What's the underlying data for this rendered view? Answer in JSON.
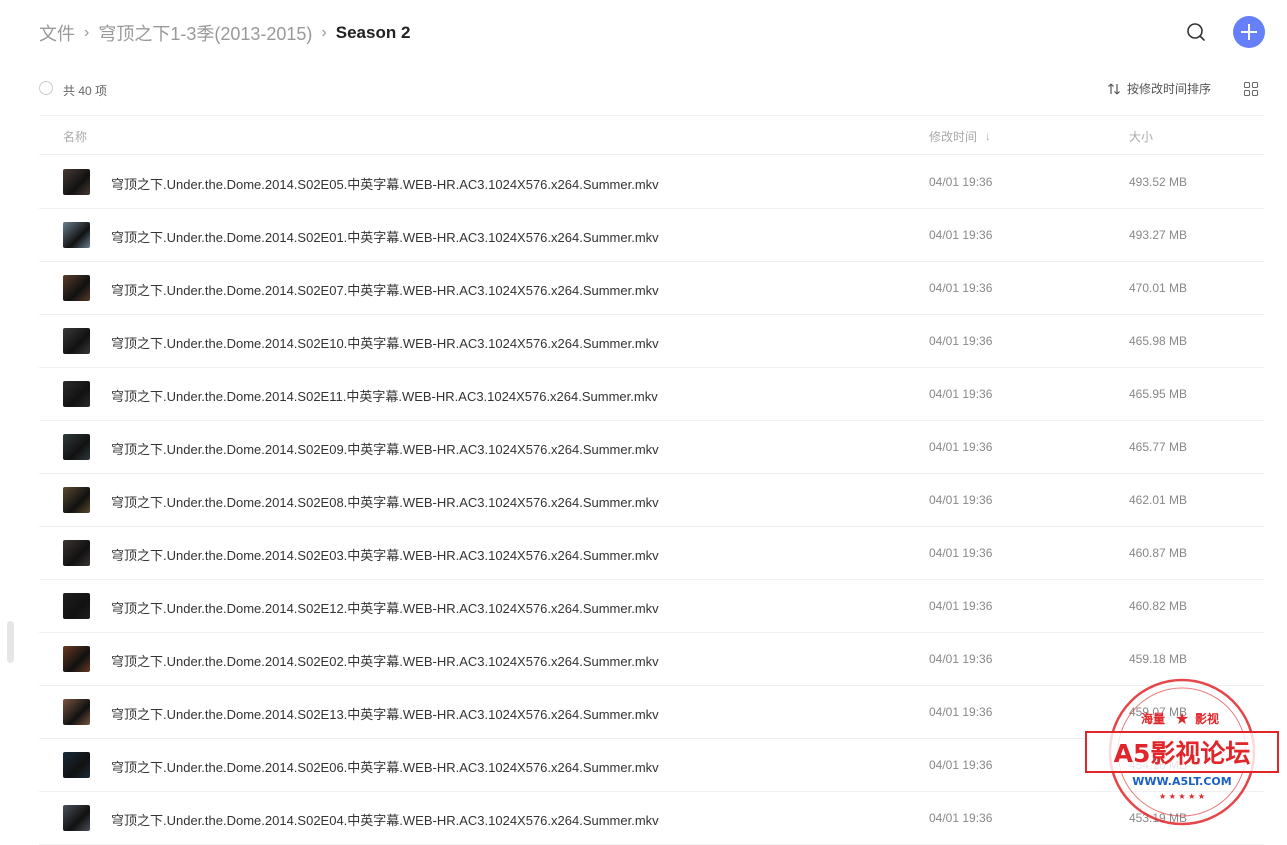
{
  "breadcrumb": {
    "root": "文件",
    "parent": "穹顶之下1-3季(2013-2015)",
    "current": "Season 2",
    "separator": "›"
  },
  "header_actions": {
    "search_icon": "search-icon",
    "add_icon": "plus-icon",
    "accent": "#6580fa"
  },
  "toolbar": {
    "count": "共 40 项",
    "sort_label": "按修改时间排序",
    "view_icon": "grid-icon"
  },
  "columns": {
    "name": "名称",
    "time": "修改时间",
    "size": "大小",
    "time_sort_arrow": "↓"
  },
  "files": [
    {
      "name": "穹顶之下.Under.the.Dome.2014.S02E05.中英字幕.WEB-HR.AC3.1024X576.x264.Summer.mkv",
      "time": "04/01 19:36",
      "size": "493.52 MB"
    },
    {
      "name": "穹顶之下.Under.the.Dome.2014.S02E01.中英字幕.WEB-HR.AC3.1024X576.x264.Summer.mkv",
      "time": "04/01 19:36",
      "size": "493.27 MB"
    },
    {
      "name": "穹顶之下.Under.the.Dome.2014.S02E07.中英字幕.WEB-HR.AC3.1024X576.x264.Summer.mkv",
      "time": "04/01 19:36",
      "size": "470.01 MB"
    },
    {
      "name": "穹顶之下.Under.the.Dome.2014.S02E10.中英字幕.WEB-HR.AC3.1024X576.x264.Summer.mkv",
      "time": "04/01 19:36",
      "size": "465.98 MB"
    },
    {
      "name": "穹顶之下.Under.the.Dome.2014.S02E11.中英字幕.WEB-HR.AC3.1024X576.x264.Summer.mkv",
      "time": "04/01 19:36",
      "size": "465.95 MB"
    },
    {
      "name": "穹顶之下.Under.the.Dome.2014.S02E09.中英字幕.WEB-HR.AC3.1024X576.x264.Summer.mkv",
      "time": "04/01 19:36",
      "size": "465.77 MB"
    },
    {
      "name": "穹顶之下.Under.the.Dome.2014.S02E08.中英字幕.WEB-HR.AC3.1024X576.x264.Summer.mkv",
      "time": "04/01 19:36",
      "size": "462.01 MB"
    },
    {
      "name": "穹顶之下.Under.the.Dome.2014.S02E03.中英字幕.WEB-HR.AC3.1024X576.x264.Summer.mkv",
      "time": "04/01 19:36",
      "size": "460.87 MB"
    },
    {
      "name": "穹顶之下.Under.the.Dome.2014.S02E12.中英字幕.WEB-HR.AC3.1024X576.x264.Summer.mkv",
      "time": "04/01 19:36",
      "size": "460.82 MB"
    },
    {
      "name": "穹顶之下.Under.the.Dome.2014.S02E02.中英字幕.WEB-HR.AC3.1024X576.x264.Summer.mkv",
      "time": "04/01 19:36",
      "size": "459.18 MB"
    },
    {
      "name": "穹顶之下.Under.the.Dome.2014.S02E13.中英字幕.WEB-HR.AC3.1024X576.x264.Summer.mkv",
      "time": "04/01 19:36",
      "size": "459.07 MB"
    },
    {
      "name": "穹顶之下.Under.the.Dome.2014.S02E06.中英字幕.WEB-HR.AC3.1024X576.x264.Summer.mkv",
      "time": "04/01 19:36",
      "size": "454.16 MB"
    },
    {
      "name": "穹顶之下.Under.the.Dome.2014.S02E04.中英字幕.WEB-HR.AC3.1024X576.x264.Summer.mkv",
      "time": "04/01 19:36",
      "size": "453.19 MB"
    }
  ],
  "thumb_colors": [
    "#4a3a35",
    "#6a7f8f",
    "#5a3b2a",
    "#3a3a3a",
    "#2c2c2c",
    "#2f3a3c",
    "#5b4a2e",
    "#3b3532",
    "#1f1f1f",
    "#6a3a22",
    "#7a5540",
    "#1a2a3a",
    "#4a4f5a"
  ],
  "watermark": {
    "top_left": "海量",
    "top_right": "影视",
    "main": "A5影视论坛",
    "url": "WWW.A5LT.COM",
    "color": "#e0262a",
    "url_color": "#1a5fc4"
  }
}
